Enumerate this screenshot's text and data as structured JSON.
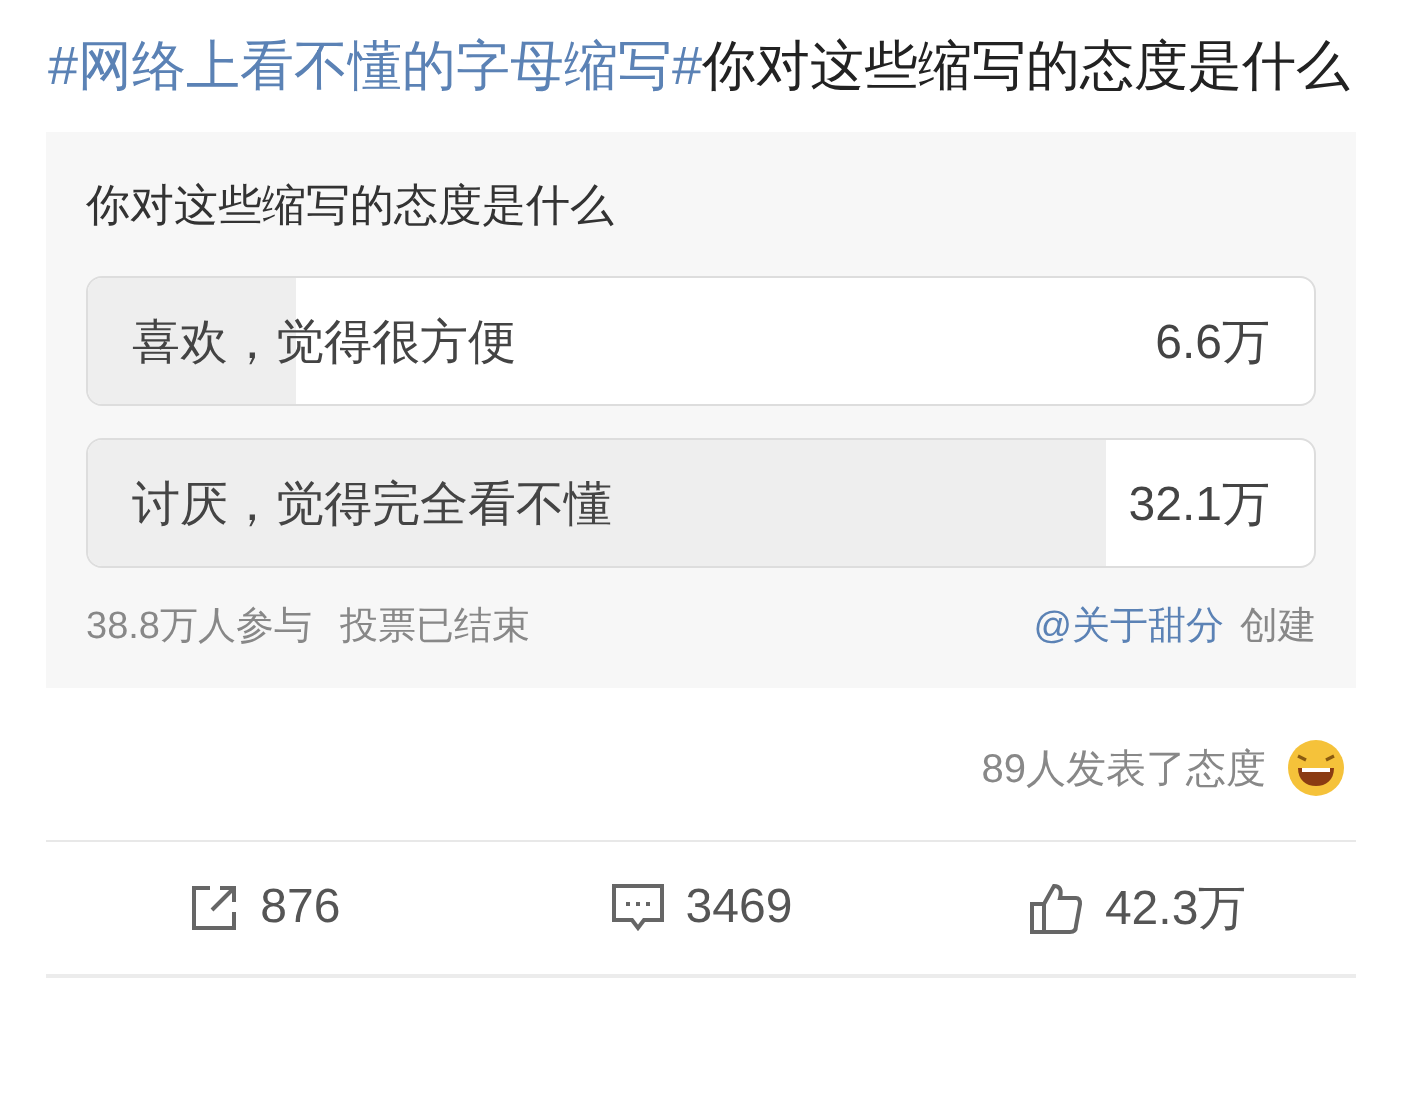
{
  "post": {
    "topic": "#网络上看不懂的字母缩写#",
    "text": "你对这些缩写的态度是什么"
  },
  "poll": {
    "question": "你对这些缩写的态度是什么",
    "options": [
      {
        "label": "喜欢，觉得很方便",
        "count": "6.6万",
        "level": 0.17
      },
      {
        "label": "讨厌，觉得完全看不懂",
        "count": "32.1万",
        "level": 0.83
      }
    ],
    "participants": "38.8万人参与",
    "status": "投票已结束",
    "creator": "@关于甜分",
    "creator_suffix": "创建"
  },
  "reactions": {
    "text": "89人发表了态度"
  },
  "actions": [
    {
      "kind": "repost",
      "count": "876"
    },
    {
      "kind": "comment",
      "count": "3469"
    },
    {
      "kind": "like",
      "count": "42.3万"
    }
  ]
}
